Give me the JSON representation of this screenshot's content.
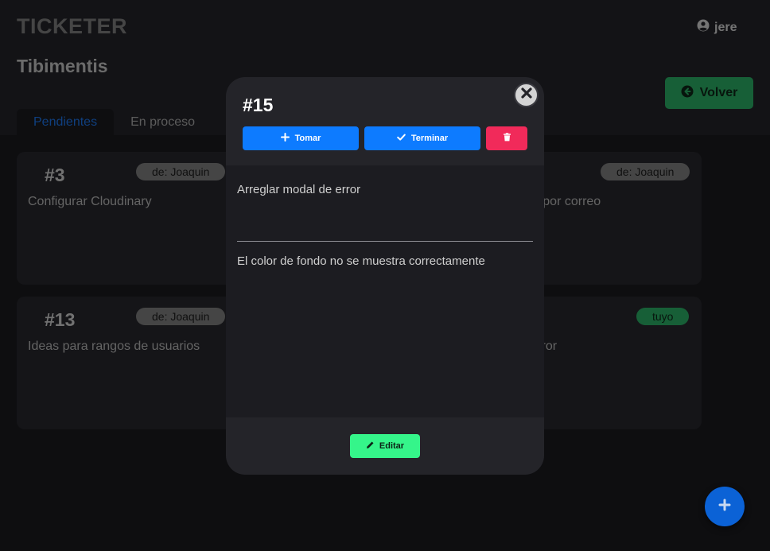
{
  "header": {
    "brand": "TICKETER",
    "user_name": "jere",
    "project_name": "Tibimentis",
    "back_label": "Volver"
  },
  "tabs": [
    {
      "label": "Pendientes",
      "active": true
    },
    {
      "label": "En proceso",
      "active": false
    }
  ],
  "cards": [
    {
      "number": "#3",
      "description": "Configurar Cloudinary",
      "badge": "de: Joaquin"
    },
    {
      "number": "",
      "description": "os usuarios por correo",
      "badge": "de: Joaquin"
    },
    {
      "number": "#13",
      "description": "Ideas para rangos de usuarios",
      "badge": "de: Joaquin"
    },
    {
      "number": "",
      "description": "modal de error",
      "badge": "tuyo"
    }
  ],
  "modal": {
    "ticket_number": "#15",
    "take_label": "Tomar",
    "finish_label": "Terminar",
    "ticket_title": "Arreglar modal de error",
    "ticket_description": "El color de fondo no se muestra correctamente",
    "edit_label": "Editar"
  },
  "icons": {
    "user": "user-circle-icon",
    "back": "arrow-circle-left-icon",
    "close": "close-icon",
    "take": "plus-icon",
    "finish": "check-icon",
    "delete": "trash-icon",
    "edit": "pencil-icon",
    "fab": "plus-icon"
  },
  "colors": {
    "accent_blue": "#0d7bff",
    "success_green": "#2fbf6e",
    "danger_red": "#f12a5a",
    "edit_green": "#35f58a"
  }
}
